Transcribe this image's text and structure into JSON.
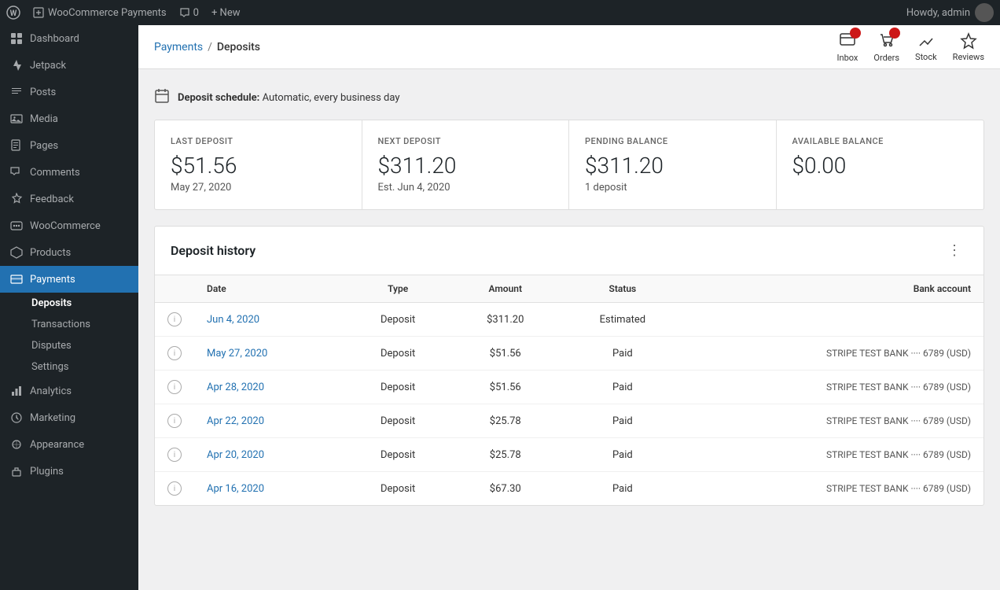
{
  "topbar": {
    "wp_logo": "W",
    "site_name": "WooCommerce Payments",
    "comments_label": "0",
    "new_label": "+ New",
    "howdy": "Howdy, admin"
  },
  "sidebar": {
    "items": [
      {
        "id": "dashboard",
        "label": "Dashboard",
        "icon": "dashboard"
      },
      {
        "id": "jetpack",
        "label": "Jetpack",
        "icon": "jetpack"
      },
      {
        "id": "posts",
        "label": "Posts",
        "icon": "posts"
      },
      {
        "id": "media",
        "label": "Media",
        "icon": "media"
      },
      {
        "id": "pages",
        "label": "Pages",
        "icon": "pages"
      },
      {
        "id": "comments",
        "label": "Comments",
        "icon": "comments"
      },
      {
        "id": "feedback",
        "label": "Feedback",
        "icon": "feedback"
      },
      {
        "id": "woocommerce",
        "label": "WooCommerce",
        "icon": "woocommerce"
      },
      {
        "id": "products",
        "label": "Products",
        "icon": "products"
      },
      {
        "id": "payments",
        "label": "Payments",
        "icon": "payments",
        "active": true
      },
      {
        "id": "analytics",
        "label": "Analytics",
        "icon": "analytics"
      },
      {
        "id": "marketing",
        "label": "Marketing",
        "icon": "marketing"
      },
      {
        "id": "appearance",
        "label": "Appearance",
        "icon": "appearance"
      },
      {
        "id": "plugins",
        "label": "Plugins",
        "icon": "plugins"
      }
    ],
    "payments_sub": [
      {
        "id": "deposits",
        "label": "Deposits",
        "active": true
      },
      {
        "id": "transactions",
        "label": "Transactions"
      },
      {
        "id": "disputes",
        "label": "Disputes"
      },
      {
        "id": "settings",
        "label": "Settings"
      }
    ]
  },
  "header": {
    "breadcrumb_parent": "Payments",
    "breadcrumb_sep": "/",
    "breadcrumb_current": "Deposits",
    "icons": [
      {
        "id": "inbox",
        "label": "Inbox",
        "badge": true,
        "badge_count": ""
      },
      {
        "id": "orders",
        "label": "Orders",
        "badge": true,
        "badge_count": ""
      },
      {
        "id": "stock",
        "label": "Stock",
        "badge": false
      },
      {
        "id": "reviews",
        "label": "Reviews",
        "badge": false
      }
    ]
  },
  "deposit_schedule": {
    "label": "Deposit schedule:",
    "value": "Automatic, every business day"
  },
  "stats": [
    {
      "id": "last_deposit",
      "label": "LAST DEPOSIT",
      "value": "$51.56",
      "sub": "May 27, 2020"
    },
    {
      "id": "next_deposit",
      "label": "NEXT DEPOSIT",
      "value": "$311.20",
      "sub": "Est. Jun 4, 2020"
    },
    {
      "id": "pending_balance",
      "label": "PENDING BALANCE",
      "value": "$311.20",
      "sub": "1 deposit"
    },
    {
      "id": "available_balance",
      "label": "AVAILABLE BALANCE",
      "value": "$0.00",
      "sub": ""
    }
  ],
  "deposit_history": {
    "title": "Deposit history",
    "columns": [
      "Date",
      "Type",
      "Amount",
      "Status",
      "Bank account"
    ],
    "rows": [
      {
        "date": "Jun 4, 2020",
        "type": "Deposit",
        "amount": "$311.20",
        "status": "Estimated",
        "bank": ""
      },
      {
        "date": "May 27, 2020",
        "type": "Deposit",
        "amount": "$51.56",
        "status": "Paid",
        "bank": "STRIPE TEST BANK ···· 6789 (USD)"
      },
      {
        "date": "Apr 28, 2020",
        "type": "Deposit",
        "amount": "$51.56",
        "status": "Paid",
        "bank": "STRIPE TEST BANK ···· 6789 (USD)"
      },
      {
        "date": "Apr 22, 2020",
        "type": "Deposit",
        "amount": "$25.78",
        "status": "Paid",
        "bank": "STRIPE TEST BANK ···· 6789 (USD)"
      },
      {
        "date": "Apr 20, 2020",
        "type": "Deposit",
        "amount": "$25.78",
        "status": "Paid",
        "bank": "STRIPE TEST BANK ···· 6789 (USD)"
      },
      {
        "date": "Apr 16, 2020",
        "type": "Deposit",
        "amount": "$67.30",
        "status": "Paid",
        "bank": "STRIPE TEST BANK ···· 6789 (USD)"
      }
    ]
  }
}
